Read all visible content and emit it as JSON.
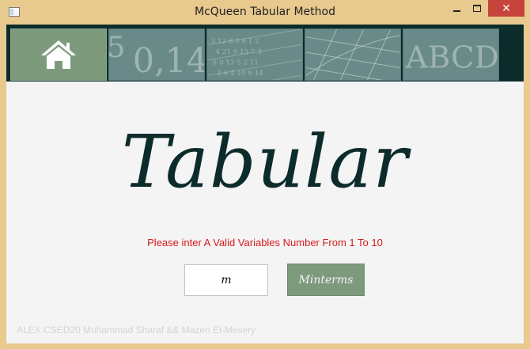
{
  "window": {
    "title": "McQueen Tabular Method",
    "minimize_label": "—",
    "maximize_label": "☐",
    "close_label": "✕"
  },
  "navbar": {
    "tiles": [
      {
        "icon": "home-icon",
        "active": true
      },
      {
        "icon": "numbers-tile",
        "art_text": "0,14"
      },
      {
        "icon": "grid-numbers-tile"
      },
      {
        "icon": "graph-paper-tile"
      },
      {
        "icon": "letters-tile",
        "art_text": "ABCD"
      }
    ]
  },
  "main": {
    "heading": "Tabular",
    "error_message": "Please inter A Valid Variables Number From 1 To 10",
    "variables_input": {
      "value": "m",
      "placeholder": ""
    },
    "minterms_button_label": "Minterms",
    "footer_credit": "ALEX CSED20 Muhammad Sharaf && Mazen El-Mesery"
  },
  "colors": {
    "nav_background": "#0c2c2b",
    "accent_green": "#7d9a7d",
    "heading_color": "#0c2c2b",
    "error_color": "#d91a1a",
    "close_button": "#c7433b"
  }
}
